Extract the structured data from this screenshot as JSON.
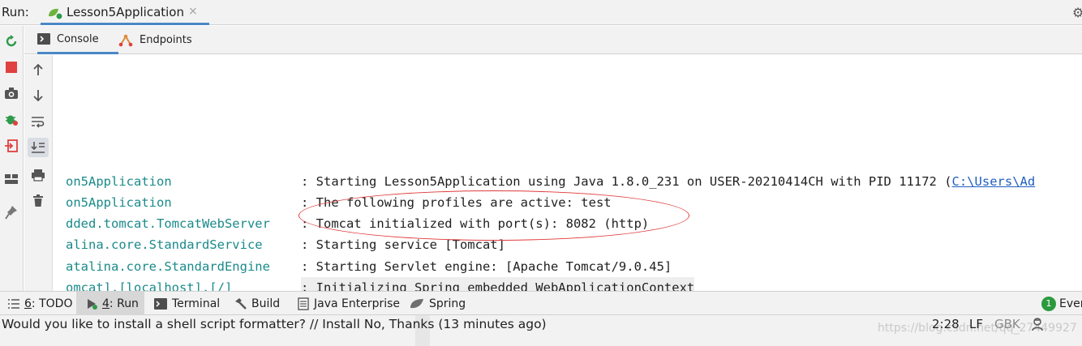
{
  "run": {
    "label": "Run:",
    "tab_title": "Lesson5Application",
    "tab_close": "×"
  },
  "subtabs": [
    {
      "label": "Console",
      "active": true
    },
    {
      "label": "Endpoints",
      "active": false
    }
  ],
  "console": {
    "lines": [
      {
        "logger": "on5Application",
        "message": ": Starting Lesson5Application using Java 1.8.0_231 on USER-20210414CH with PID 11172 (",
        "link": "C:\\Users\\Ad"
      },
      {
        "logger": "on5Application",
        "message": ": The following profiles are active: test"
      },
      {
        "logger": "dded.tomcat.TomcatWebServer",
        "message": ": Tomcat initialized with port(s): 8082 (http)"
      },
      {
        "logger": "alina.core.StandardService",
        "message": ": Starting service [Tomcat]"
      },
      {
        "logger": "atalina.core.StandardEngine",
        "message": ": Starting Servlet engine: [Apache Tomcat/9.0.45]"
      },
      {
        "logger": "omcat].[localhost].[/]",
        "message": ": Initializing Spring embedded WebApplicationContext"
      }
    ]
  },
  "tool_windows": [
    {
      "num": "6",
      "label": ": TODO",
      "icon": "list-icon"
    },
    {
      "num": "4",
      "label": ": Run",
      "icon": "run-icon",
      "active": true
    },
    {
      "label": "Terminal",
      "icon": "terminal-icon"
    },
    {
      "label": "Build",
      "icon": "hammer-icon"
    },
    {
      "label": "Java Enterprise",
      "icon": "java-enterprise-icon"
    },
    {
      "label": "Spring",
      "icon": "spring-leaf-icon"
    }
  ],
  "events": {
    "count": "1",
    "label": "Even"
  },
  "status": {
    "message": "Would you like to install a shell script formatter? // Install   No, Thanks (13 minutes ago)",
    "position": "2:28",
    "line_sep": "LF",
    "encoding": "GBK"
  },
  "watermark": "https://blog.csdn.net/qq_27449927",
  "colors": {
    "accent": "#4a88c7",
    "logger_teal": "#1b8a8a",
    "annotation_red": "#e03a3a",
    "rerun_green": "#2e9a4a",
    "stop_red": "#e0403f"
  }
}
